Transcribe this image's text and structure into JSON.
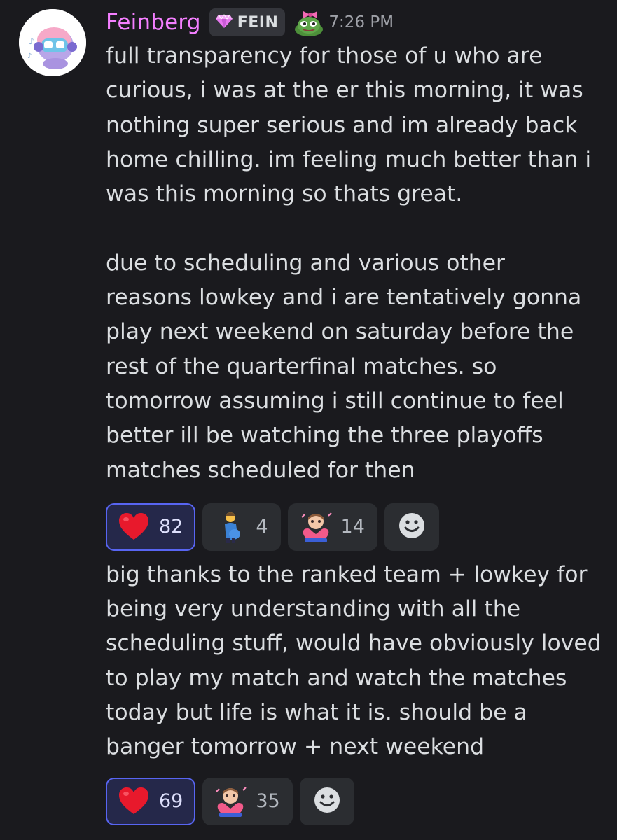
{
  "author": {
    "name": "Feinberg",
    "tag": "FEIN",
    "timestamp": "7:26 PM",
    "name_color": "#f47fff"
  },
  "messages": [
    {
      "text": "full transparency for those of u who are\ncurious, i was at the er this morning, it was\nnothing super serious and im already back\nhome chilling. im feeling much better than i\nwas this morning so thats great.\n\ndue to scheduling and various other\nreasons lowkey and i are tentatively gonna\nplay next weekend on saturday before the\nrest of the quarterfinal matches. so\ntomorrow assuming i still continue to feel\nbetter ill be watching the three playoffs\nmatches scheduled for then",
      "reactions": [
        {
          "emoji": "heart-emoji",
          "count": "82",
          "reacted": true
        },
        {
          "emoji": "pregnant-man-emoji",
          "count": "4",
          "reacted": false
        },
        {
          "emoji": "heart-hug-custom-emoji",
          "count": "14",
          "reacted": false
        }
      ]
    },
    {
      "text": "big thanks to the ranked team + lowkey for\nbeing very understanding with all the\nscheduling stuff, would have obviously loved\nto play my match and watch the matches\ntoday but life is what it is. should be a\nbanger tomorrow + next weekend",
      "reactions": [
        {
          "emoji": "heart-emoji",
          "count": "69",
          "reacted": true
        },
        {
          "emoji": "heart-hug-custom-emoji",
          "count": "35",
          "reacted": false
        }
      ]
    }
  ],
  "colors": {
    "background": "#1a1a1e",
    "reaction_bg": "#2b2d31",
    "reacted_bg": "#25284a",
    "reacted_border": "#5865f2"
  }
}
